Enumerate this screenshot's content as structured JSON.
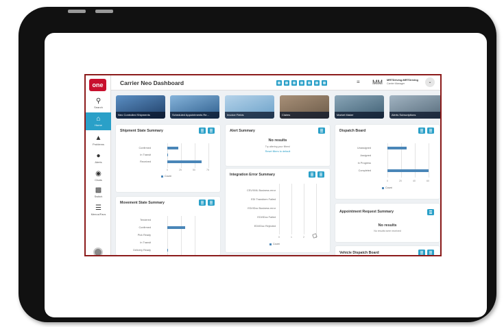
{
  "app": {
    "logo_text": "one",
    "page_title": "Carrier Neo Dashboard",
    "user_initials": "MM",
    "user_name": "MRTDriving.MRTDriving",
    "user_role": "Carrier Manager"
  },
  "sidebar": {
    "items": [
      {
        "label": "Search",
        "icon": "search-icon"
      },
      {
        "label": "Home",
        "icon": "home-icon",
        "active": true
      },
      {
        "label": "Problems",
        "icon": "warning-icon"
      },
      {
        "label": "Alerts",
        "icon": "bell-icon"
      },
      {
        "label": "Chats",
        "icon": "chat-icon"
      },
      {
        "label": "Switch",
        "icon": "switch-icon"
      },
      {
        "label": "Menus/Favs",
        "icon": "menu-icon"
      }
    ]
  },
  "tiles": [
    {
      "label": "Neo Controlled Shipments",
      "color": "#1f3e66"
    },
    {
      "label": "Scheduled Appointments Re...",
      "color": "#2d5d8c"
    },
    {
      "label": "Invoice Fields",
      "color": "#6aa0c8"
    },
    {
      "label": "Claims",
      "color": "#6b5a48"
    },
    {
      "label": "Market Maker",
      "color": "#3f5f73"
    },
    {
      "label": "Alerts Subscriptions",
      "color": "#556a7a"
    }
  ],
  "shipment_state": {
    "title": "Shipment State Summary",
    "categories": [
      "Confirmed",
      "In Transit",
      "Received"
    ],
    "values": [
      20,
      1,
      63
    ],
    "ticks": [
      "0",
      "25",
      "50",
      "75"
    ],
    "legend": "Count"
  },
  "alert_summary": {
    "title": "Alert Summary",
    "no_results": "No results",
    "hint": "Try altering your filters!",
    "reset_link": "Reset filters to default"
  },
  "dispatch_board": {
    "title": "Dispatch Board",
    "categories": [
      "Unassigned",
      "Assigned",
      "In Progress",
      "Completed"
    ],
    "values": [
      18,
      0,
      0,
      38
    ],
    "ticks": [
      "0",
      "20",
      "40",
      "60"
    ],
    "legend": "Count"
  },
  "integration_error": {
    "title": "Integration Error Summary",
    "categories": [
      "CSV/XML Business error",
      "EDI Transform Failed",
      "EDI/IDoc Business error",
      "EDI/IDoc Failed",
      "EDI/IDoc Rejected"
    ],
    "values": [
      0,
      0,
      0,
      0,
      0
    ],
    "ticks": [
      "0",
      "1",
      "2",
      "3"
    ],
    "legend": "Count"
  },
  "movement_state": {
    "title": "Movement State Summary",
    "categories": [
      "Tendered",
      "Confirmed",
      "Pick Ready",
      "In Transit",
      "Delivery Ready"
    ],
    "values": [
      0,
      12,
      0,
      0,
      1
    ]
  },
  "appointment_request": {
    "title": "Appointment Request Summary",
    "no_results": "No results",
    "hint": "No results were received"
  },
  "vehicle_dispatch": {
    "title": "Vehicle Dispatch Board"
  }
}
